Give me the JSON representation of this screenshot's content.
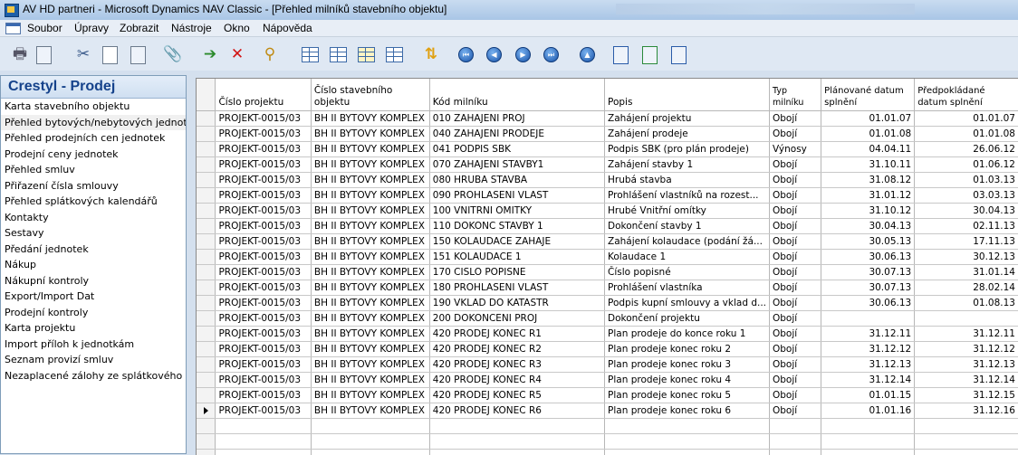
{
  "window": {
    "title": "AV HD partneri - Microsoft Dynamics NAV Classic - [Přehled milníků stavebního objektu]"
  },
  "menu": [
    "Soubor",
    "Úpravy",
    "Zobrazit",
    "Nástroje",
    "Okno",
    "Nápověda"
  ],
  "nav": {
    "header": "Crestyl - Prodej",
    "items": [
      "Karta stavebního objektu",
      "Přehled bytových/nebytových jednotek",
      "Přehled prodejních cen jednotek",
      "Prodejní ceny jednotek",
      "Přehled smluv",
      "Přiřazení čísla smlouvy",
      "Přehled splátkových kalendářů",
      "Kontakty",
      "Sestavy",
      "Předání jednotek",
      "Nákup",
      "Nákupní kontroly",
      "Export/Import Dat",
      "Prodejní kontroly",
      "Karta projektu",
      "Import příloh k jednotkám",
      "Seznam provizí smluv",
      "Nezaplacené zálohy ze splátkového kalendáře"
    ]
  },
  "grid": {
    "columns": [
      "Číslo projektu",
      "Číslo stavebního objektu",
      "Kód milníku",
      "Popis",
      "Typ milníku",
      "Plánované datum splnění",
      "Předpokládané datum splnění"
    ],
    "rows": [
      [
        "PROJEKT-0015/03",
        "BH II BYTOVY KOMPLEX",
        "010 ZAHAJENI PROJ",
        "Zahájení projektu",
        "Obojí",
        "01.01.07",
        "01.01.07"
      ],
      [
        "PROJEKT-0015/03",
        "BH II BYTOVY KOMPLEX",
        "040 ZAHAJENI PRODEJE",
        "Zahájení prodeje",
        "Obojí",
        "01.01.08",
        "01.01.08"
      ],
      [
        "PROJEKT-0015/03",
        "BH II BYTOVY KOMPLEX",
        "041 PODPIS SBK",
        "Podpis SBK (pro plán prodeje)",
        "Výnosy",
        "04.04.11",
        "26.06.12"
      ],
      [
        "PROJEKT-0015/03",
        "BH II BYTOVY KOMPLEX",
        "070 ZAHAJENI STAVBY1",
        "Zahájení stavby 1",
        "Obojí",
        "31.10.11",
        "01.06.12"
      ],
      [
        "PROJEKT-0015/03",
        "BH II BYTOVY KOMPLEX",
        "080 HRUBA STAVBA",
        "Hrubá stavba",
        "Obojí",
        "31.08.12",
        "01.03.13"
      ],
      [
        "PROJEKT-0015/03",
        "BH II BYTOVY KOMPLEX",
        "090 PROHLASENI VLAST",
        "Prohlášení vlastníků na rozest...",
        "Obojí",
        "31.01.12",
        "03.03.13"
      ],
      [
        "PROJEKT-0015/03",
        "BH II BYTOVY KOMPLEX",
        "100 VNITRNI OMITKY",
        "Hrubé Vnitřní omítky",
        "Obojí",
        "31.10.12",
        "30.04.13"
      ],
      [
        "PROJEKT-0015/03",
        "BH II BYTOVY KOMPLEX",
        "110 DOKONC STAVBY 1",
        "Dokončení stavby 1",
        "Obojí",
        "30.04.13",
        "02.11.13"
      ],
      [
        "PROJEKT-0015/03",
        "BH II BYTOVY KOMPLEX",
        "150 KOLAUDACE ZAHAJE",
        "Zahájení kolaudace (podání žá...",
        "Obojí",
        "30.05.13",
        "17.11.13"
      ],
      [
        "PROJEKT-0015/03",
        "BH II BYTOVY KOMPLEX",
        "151 KOLAUDACE 1",
        "Kolaudace 1",
        "Obojí",
        "30.06.13",
        "30.12.13"
      ],
      [
        "PROJEKT-0015/03",
        "BH II BYTOVY KOMPLEX",
        "170 CISLO POPISNE",
        "Číslo popisné",
        "Obojí",
        "30.07.13",
        "31.01.14"
      ],
      [
        "PROJEKT-0015/03",
        "BH II BYTOVY KOMPLEX",
        "180 PROHLASENI VLAST",
        "Prohlášení vlastníka",
        "Obojí",
        "30.07.13",
        "28.02.14"
      ],
      [
        "PROJEKT-0015/03",
        "BH II BYTOVY KOMPLEX",
        "190 VKLAD DO KATASTR",
        "Podpis kupní smlouvy a vklad d...",
        "Obojí",
        "30.06.13",
        "01.08.13"
      ],
      [
        "PROJEKT-0015/03",
        "BH II BYTOVY KOMPLEX",
        "200 DOKONCENI PROJ",
        "Dokončení projektu",
        "Obojí",
        "",
        ""
      ],
      [
        "PROJEKT-0015/03",
        "BH II BYTOVY KOMPLEX",
        "420 PRODEJ KONEC R1",
        "Plan prodeje do konce roku 1",
        "Obojí",
        "31.12.11",
        "31.12.11"
      ],
      [
        "PROJEKT-0015/03",
        "BH II BYTOVY KOMPLEX",
        "420 PRODEJ KONEC R2",
        "Plan prodeje konec roku 2",
        "Obojí",
        "31.12.12",
        "31.12.12"
      ],
      [
        "PROJEKT-0015/03",
        "BH II BYTOVY KOMPLEX",
        "420 PRODEJ KONEC R3",
        "Plan prodeje konec roku 3",
        "Obojí",
        "31.12.13",
        "31.12.13"
      ],
      [
        "PROJEKT-0015/03",
        "BH II BYTOVY KOMPLEX",
        "420 PRODEJ KONEC R4",
        "Plan prodeje konec roku 4",
        "Obojí",
        "31.12.14",
        "31.12.14"
      ],
      [
        "PROJEKT-0015/03",
        "BH II BYTOVY KOMPLEX",
        "420 PRODEJ KONEC R5",
        "Plan prodeje konec roku 5",
        "Obojí",
        "01.01.15",
        "31.12.15"
      ],
      [
        "PROJEKT-0015/03",
        "BH II BYTOVY KOMPLEX",
        "420 PRODEJ KONEC R6",
        "Plan prodeje konec roku 6",
        "Obojí",
        "01.01.16",
        "31.12.16"
      ]
    ]
  },
  "toolbar_icons": [
    "print-icon",
    "print-preview-icon",
    "cut-icon",
    "copy-icon",
    "paste-icon",
    "attach-icon",
    "apply-icon",
    "delete-icon",
    "find-icon",
    "list-icon",
    "card-icon",
    "export-icon",
    "table-icon",
    "refresh-icon",
    "first-record-icon",
    "previous-record-icon",
    "next-record-icon",
    "last-record-icon",
    "up-icon",
    "word-icon",
    "excel-icon",
    "approve-icon"
  ]
}
